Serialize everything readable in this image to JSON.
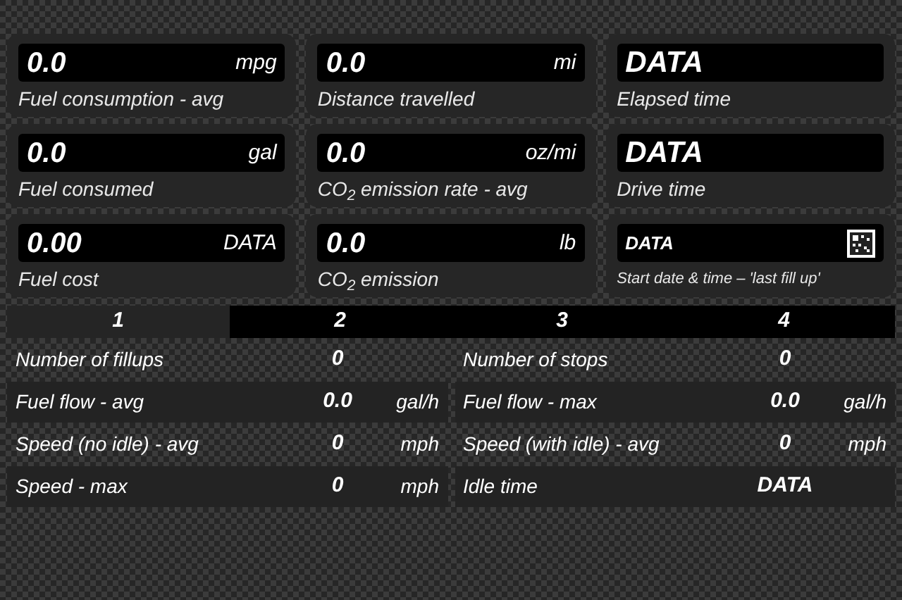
{
  "cards": [
    {
      "kind": "value",
      "value": "0.0",
      "unit": "mpg",
      "label": "Fuel consumption - avg"
    },
    {
      "kind": "value",
      "value": "0.0",
      "unit": "mi",
      "label": "Distance travelled"
    },
    {
      "kind": "value",
      "value": "DATA",
      "label": "Elapsed time"
    },
    {
      "kind": "value",
      "value": "0.0",
      "unit": "gal",
      "label": "Fuel consumed"
    },
    {
      "kind": "value",
      "value": "0.0",
      "unit": "oz/mi",
      "label": "CO$_{2}$ emission rate - avg"
    },
    {
      "kind": "value",
      "value": "DATA",
      "label": "Drive time"
    },
    {
      "kind": "value",
      "value": "0.00",
      "unit": "DATA",
      "label": "Fuel cost"
    },
    {
      "kind": "value",
      "value": "0.0",
      "unit": "lb",
      "label": "CO$_{2}$ emission"
    },
    {
      "kind": "date",
      "value": "DATA",
      "label": "Start date & time – 'last fill up'"
    }
  ],
  "tabs": [
    {
      "label": "1",
      "selected": true
    },
    {
      "label": "2",
      "selected": false
    },
    {
      "label": "3",
      "selected": false
    },
    {
      "label": "4",
      "selected": false
    }
  ],
  "stats": [
    [
      {
        "label": "Number of fillups",
        "value": "0"
      },
      {
        "label": "Number of stops",
        "value": "0"
      }
    ],
    [
      {
        "label": "Fuel flow - avg",
        "value": "0.0",
        "unit": "gal/h"
      },
      {
        "label": "Fuel flow - max",
        "value": "0.0",
        "unit": "gal/h"
      }
    ],
    [
      {
        "label": "Speed (no idle) - avg",
        "value": "0",
        "unit": "mph"
      },
      {
        "label": "Speed (with idle) - avg",
        "value": "0",
        "unit": "mph"
      }
    ],
    [
      {
        "label": "Speed - max",
        "value": "0",
        "unit": "mph"
      },
      {
        "label": "Idle time",
        "value": "DATA"
      }
    ]
  ]
}
